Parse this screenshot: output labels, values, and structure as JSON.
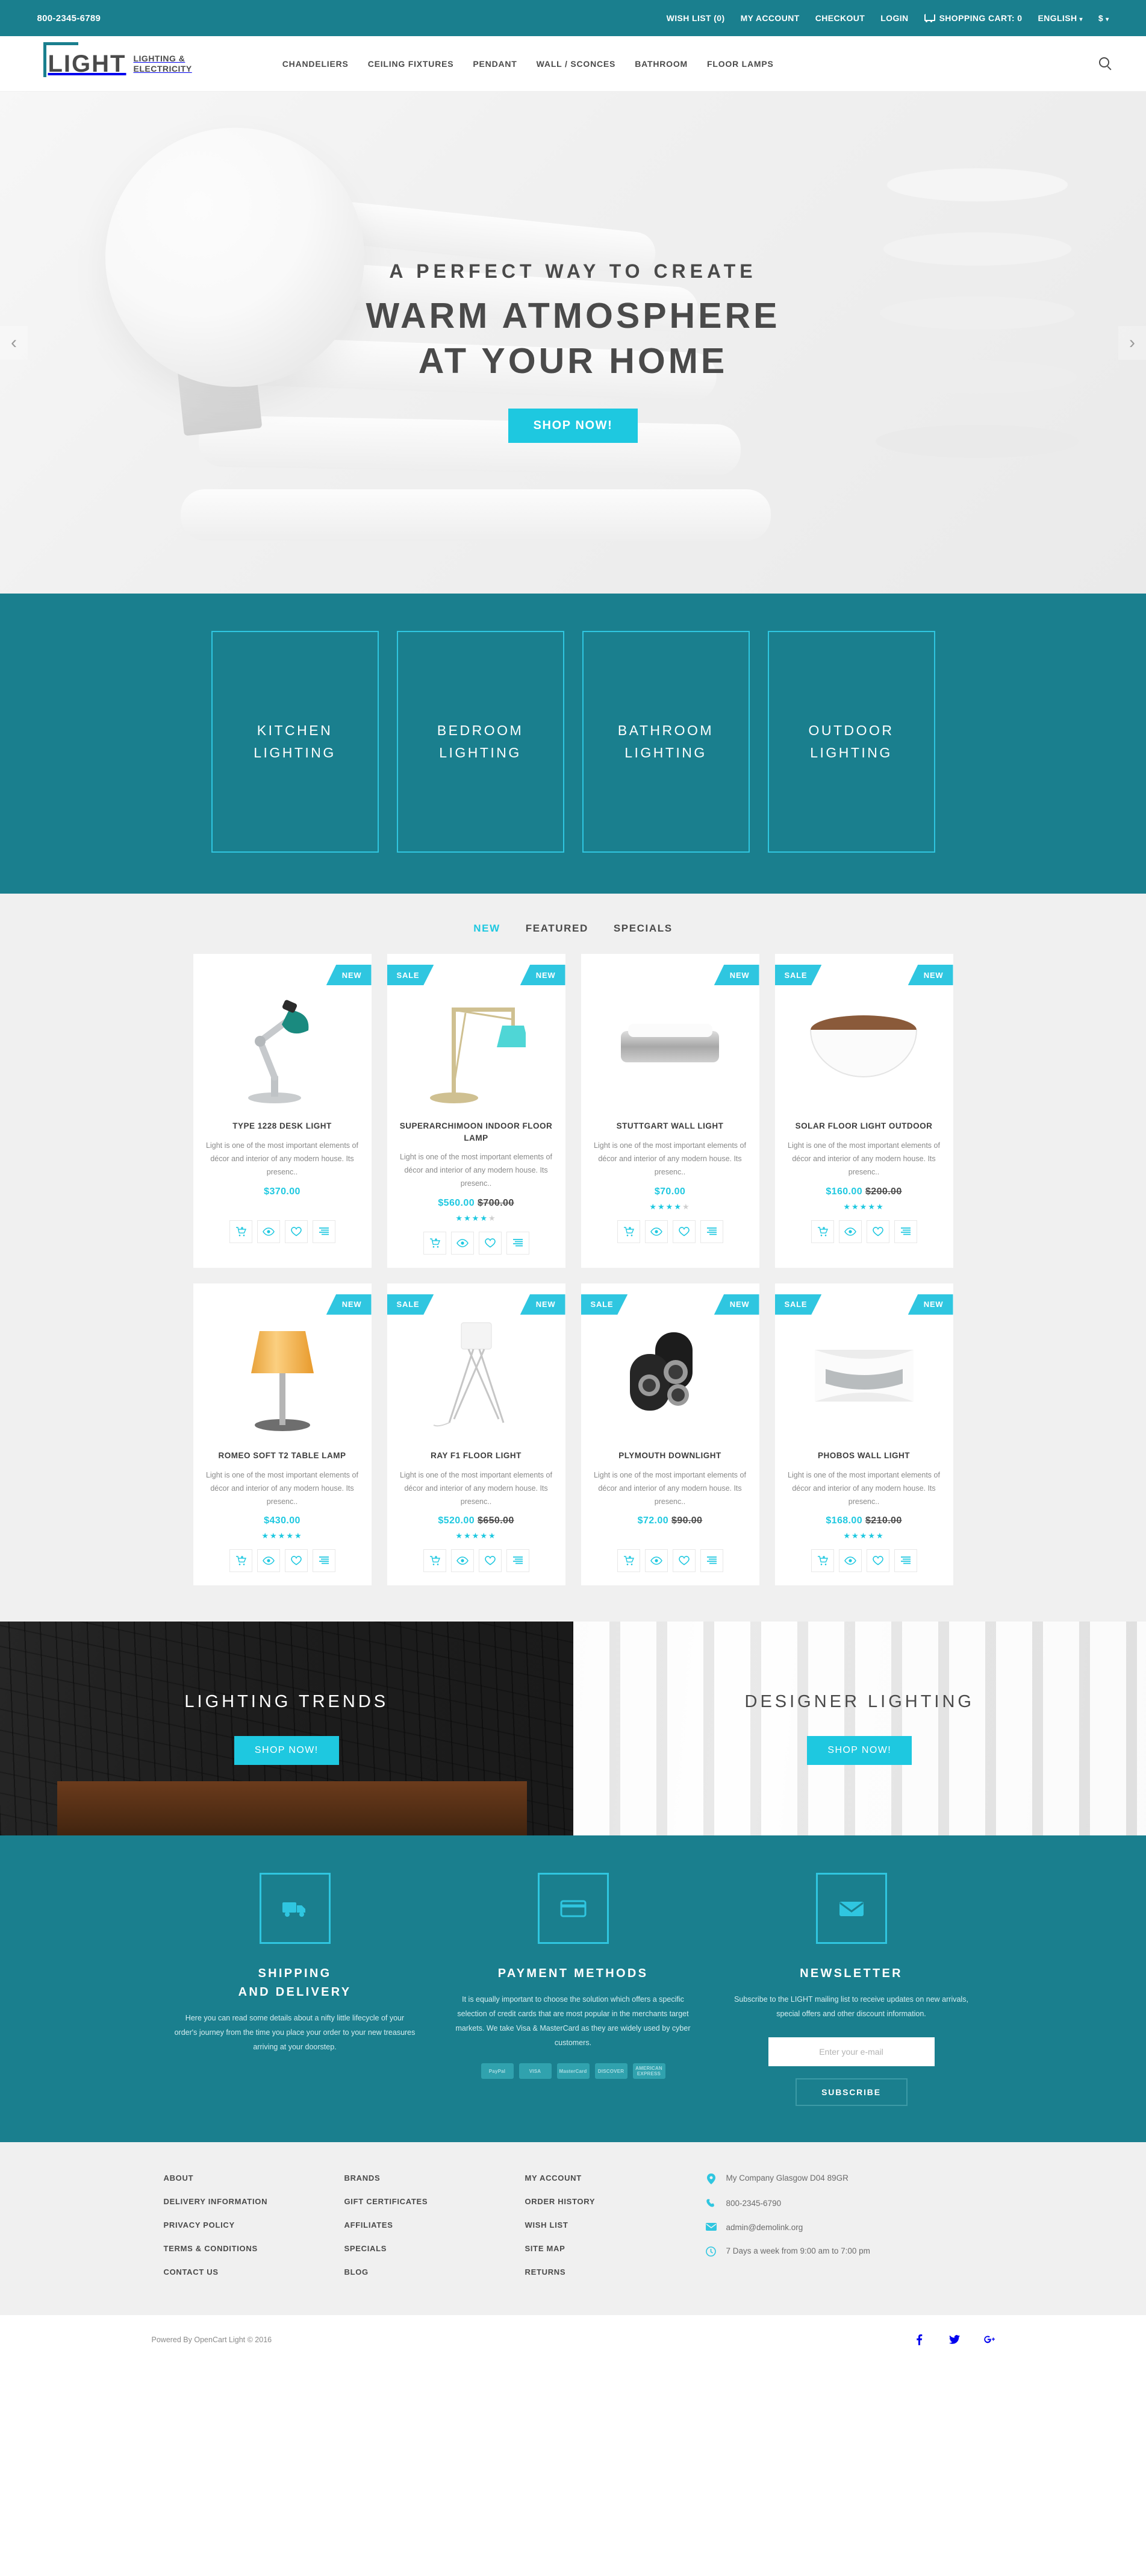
{
  "topbar": {
    "phone": "800-2345-6789",
    "links": [
      {
        "label": "WISH LIST (0)",
        "name": "wish-list"
      },
      {
        "label": "MY ACCOUNT",
        "name": "my-account"
      },
      {
        "label": "CHECKOUT",
        "name": "checkout"
      },
      {
        "label": "LOGIN",
        "name": "login"
      }
    ],
    "cart_label": "SHOPPING CART: 0",
    "language": "ENGLISH",
    "currency": "$"
  },
  "header": {
    "logo_word": "LIGHT",
    "logo_sub_line1": "LIGHTING &",
    "logo_sub_line2": "ELECTRICITY",
    "nav": [
      "CHANDELIERS",
      "CEILING FIXTURES",
      "PENDANT",
      "WALL / SCONCES",
      "BATHROOM",
      "FLOOR LAMPS"
    ]
  },
  "hero": {
    "kicker": "A PERFECT WAY TO CREATE",
    "title_line1": "WARM ATMOSPHERE",
    "title_line2": "AT YOUR HOME",
    "button": "SHOP NOW!",
    "prev": "‹",
    "next": "›"
  },
  "categories": [
    {
      "line1": "KITCHEN",
      "line2": "LIGHTING"
    },
    {
      "line1": "BEDROOM",
      "line2": "LIGHTING"
    },
    {
      "line1": "BATHROOM",
      "line2": "LIGHTING"
    },
    {
      "line1": "OUTDOOR",
      "line2": "LIGHTING"
    }
  ],
  "products": {
    "tabs": [
      {
        "label": "NEW",
        "active": true
      },
      {
        "label": "FEATURED",
        "active": false
      },
      {
        "label": "SPECIALS",
        "active": false
      }
    ],
    "desc": "Light is one of the most important elements of décor and interior of any modern house. Its presenc..",
    "actions": [
      "add-to-cart",
      "quick-view",
      "wishlist",
      "compare"
    ],
    "items": [
      {
        "name": "TYPE 1228 DESK LIGHT",
        "price": "$370.00",
        "old": "",
        "sale": false,
        "new": true,
        "stars": 0,
        "art": "desk-lamp"
      },
      {
        "name": "SUPERARCHIMOON INDOOR FLOOR LAMP",
        "price": "$560.00",
        "old": "$700.00",
        "sale": true,
        "new": true,
        "stars": 4,
        "art": "arc-lamp"
      },
      {
        "name": "STUTTGART WALL LIGHT",
        "price": "$70.00",
        "old": "",
        "sale": false,
        "new": true,
        "stars": 4,
        "art": "wall-box"
      },
      {
        "name": "SOLAR FLOOR LIGHT OUTDOOR",
        "price": "$160.00",
        "old": "$200.00",
        "sale": true,
        "new": true,
        "stars": 5,
        "art": "bowl"
      },
      {
        "name": "ROMEO SOFT T2 TABLE LAMP",
        "price": "$430.00",
        "old": "",
        "sale": false,
        "new": true,
        "stars": 5,
        "art": "table-lamp"
      },
      {
        "name": "RAY F1 FLOOR LIGHT",
        "price": "$520.00",
        "old": "$650.00",
        "sale": true,
        "new": true,
        "stars": 5,
        "art": "tripod"
      },
      {
        "name": "PLYMOUTH DOWNLIGHT",
        "price": "$72.00",
        "old": "$90.00",
        "sale": true,
        "new": true,
        "stars": 0,
        "art": "downlight"
      },
      {
        "name": "PHOBOS WALL LIGHT",
        "price": "$168.00",
        "old": "$210.00",
        "sale": true,
        "new": true,
        "stars": 5,
        "art": "sconce"
      }
    ],
    "badge_sale": "SALE",
    "badge_new": "NEW"
  },
  "promos": [
    {
      "title": "LIGHTING TRENDS",
      "button": "SHOP NOW!",
      "theme": "dark"
    },
    {
      "title": "DESIGNER LIGHTING",
      "button": "SHOP NOW!",
      "theme": "light"
    }
  ],
  "services": [
    {
      "icon": "truck-icon",
      "title_line1": "SHIPPING",
      "title_line2": "AND DELIVERY",
      "text": "Here you can read some details about a nifty little lifecycle of your order's journey from the time you place your order to your new treasures arriving at your doorstep."
    },
    {
      "icon": "credit-card-icon",
      "title_line1": "PAYMENT METHODS",
      "title_line2": "",
      "text": "It is equally important to choose the solution which offers a specific selection of credit cards that are most popular in the merchants target markets. We take Visa & MasterCard as they are widely used by cyber customers.",
      "cards": [
        "PayPal",
        "VISA",
        "MasterCard",
        "DISCOVER",
        "AMERICAN EXPRESS"
      ]
    },
    {
      "icon": "envelope-icon",
      "title_line1": "NEWSLETTER",
      "title_line2": "",
      "text": "Subscribe to the LIGHT mailing list to receive updates on new arrivals, special offers and other discount information.",
      "input_placeholder": "Enter your e-mail",
      "button": "SUBSCRIBE"
    }
  ],
  "footer": {
    "columns": [
      [
        "ABOUT",
        "DELIVERY INFORMATION",
        "PRIVACY POLICY",
        "TERMS & CONDITIONS",
        "CONTACT US"
      ],
      [
        "BRANDS",
        "GIFT CERTIFICATES",
        "AFFILIATES",
        "SPECIALS",
        "BLOG"
      ],
      [
        "MY ACCOUNT",
        "ORDER HISTORY",
        "WISH LIST",
        "SITE MAP",
        "RETURNS"
      ]
    ],
    "contacts": [
      {
        "icon": "location-pin-icon",
        "text": "My Company Glasgow D04 89GR"
      },
      {
        "icon": "phone-icon",
        "text": "800-2345-6790"
      },
      {
        "icon": "envelope-icon",
        "text": "admin@demolink.org"
      },
      {
        "icon": "clock-icon",
        "text": "7 Days a week from 9:00 am to 7:00 pm"
      }
    ],
    "copyright": "Powered By OpenCart Light © 2016",
    "socials": [
      "facebook-icon",
      "twitter-icon",
      "google-plus-icon"
    ]
  },
  "colors": {
    "teal": "#1a7f8e",
    "cyan": "#1ec8e0",
    "badge": "#2fc6e0",
    "text": "#4a4a4a"
  }
}
